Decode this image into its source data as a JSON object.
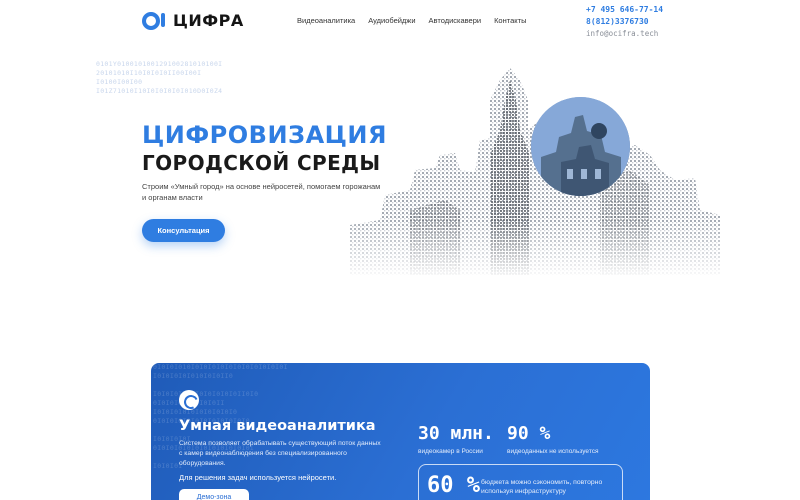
{
  "header": {
    "logo_text": "ЦИФРА",
    "nav": [
      "Видеоаналитика",
      "Аудиобейджи",
      "Автодискавери",
      "Контакты"
    ],
    "phone1": "+7 495 646-77-14",
    "phone2": "8(812)3376730",
    "email": "info@ocifra.tech"
  },
  "hero": {
    "code_lines": [
      "0101Y010010100129100281010100I",
      "20101010I10I0I0I0II00I00I",
      "I0100I00I00",
      "I01Z71010I10I0I0I0I0I010D0I0Z4"
    ],
    "title_line1": "ЦИФРОВИЗАЦИЯ",
    "title_line2": "ГОРОДСКОЙ СРЕДЫ",
    "subtitle": "Строим «Умный город» на основе нейросетей, помогаем горожанам и органам власти",
    "cta": "Консультация"
  },
  "video_card": {
    "code_lines": [
      "0I0I0I010I0I0I0I0I0I0I0I0I0I0I0I",
      "I0I0I0I0I010I0I0II0",
      "",
      "I0I0I0I0I0I0I0I0I0I0II0I0",
      "0I0I0I0I0I0I0I0II",
      "I0I0I0I0I0I0I0I0I0I0",
      "0I0I0I0I0I0I0I0I0I0I0I0",
      "",
      "I0I0I0I0I",
      "0I0I0I0I0I0I0I0I0I0I0I0I",
      "",
      "I0I0I0I"
    ],
    "title": "Умная видеоаналитика",
    "description": "Система позволяет обрабатывать существующий поток данных с камер видеонаблюдения без специализированного оборудования.",
    "note": "Для решения задач используется нейросети.",
    "demo_button": "Демо-зона",
    "stats": [
      {
        "value": "30 млн.",
        "label": "видеокамер в России"
      },
      {
        "value": "90 %",
        "label": "видеоданных не используется"
      }
    ],
    "highlight": {
      "value": "60 %",
      "label": "бюджета можно сэкономить, повторно используя инфраструктуру"
    }
  },
  "colors": {
    "accent": "#2f7de1",
    "card": "#2b6fd4"
  }
}
